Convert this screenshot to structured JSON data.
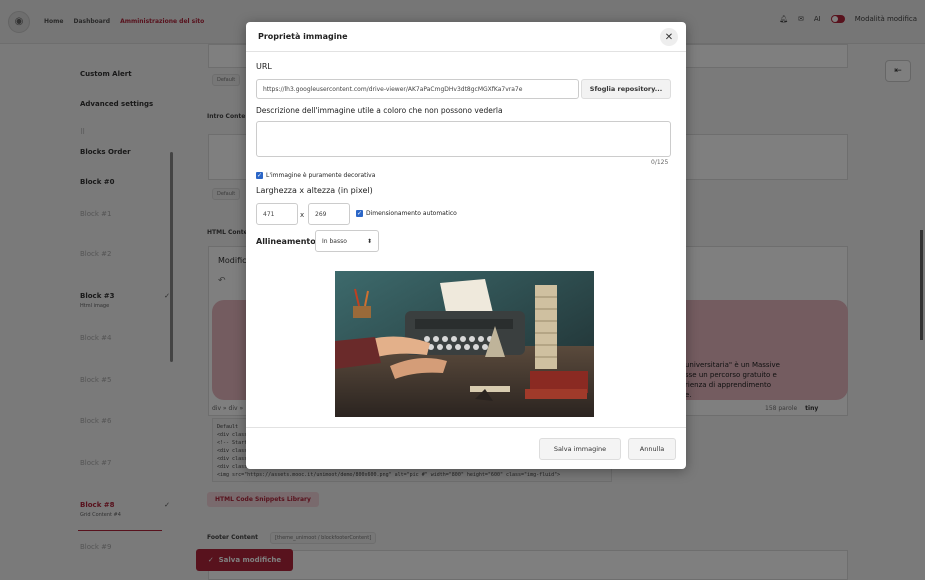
{
  "topbar": {
    "crumbs": [
      "Home",
      "Dashboard",
      "Amministrazione del sito"
    ],
    "ai_label": "AI",
    "mode_label": "Modalità modifica"
  },
  "sidebar": {
    "items": [
      {
        "label": "Custom Alert",
        "sub": ""
      },
      {
        "label": "Advanced settings",
        "sub": ""
      },
      {
        "label": "Blocks Order",
        "sub": ""
      },
      {
        "label": "Block #0",
        "sub": ""
      },
      {
        "label": "Block #1",
        "sub": ""
      },
      {
        "label": "Block #2",
        "sub": ""
      },
      {
        "label": "Block #3",
        "sub": "Html image"
      },
      {
        "label": "Block #4",
        "sub": ""
      },
      {
        "label": "Block #5",
        "sub": ""
      },
      {
        "label": "Block #6",
        "sub": ""
      },
      {
        "label": "Block #7",
        "sub": ""
      },
      {
        "label": "Block #8",
        "sub": "Grid Content #4"
      },
      {
        "label": "Block #9",
        "sub": ""
      }
    ]
  },
  "main": {
    "default_chip": "Default",
    "intro_label": "Intro Conte",
    "html_label": "HTML Conte",
    "modifica": "Modific",
    "pink_text": "universitaria\" è un Massive\nsse un percorso gratuito e\nrienza di apprendimento\ne.",
    "tiny_footer": "158 parole",
    "tiny_brand": "tiny",
    "breadcrumb_path": "div » div »",
    "code_lines": [
      "Default",
      "<div class",
      "<!-- Start -",
      "<div class",
      "<div class",
      "<div class",
      "<img src=\"https://assets.mooc.it/unimoot/demo/800x600.png\" alt=\"pic #\" width=\"800\" height=\"600\" class=\"img-fluid\">"
    ],
    "snippets_button": "HTML Code Snippets Library",
    "footer_label": "Footer Content",
    "footer_chip": "[theme_unimoot / blockfooterContent]",
    "save_button": "Salva modifiche"
  },
  "modal": {
    "title": "Proprietà immagine",
    "url_label": "URL",
    "url_value": "https://lh3.googleusercontent.com/drive-viewer/AK7aPaCmgDHv3dt8gcMGXfKa7vra7e",
    "browse_button": "Sfoglia repository...",
    "desc_label": "Descrizione dell'immagine utile a coloro che non possono vederla",
    "desc_value": "",
    "counter": "0/125",
    "decorative_label": "L'immagine è puramente decorativa",
    "size_label": "Larghezza x altezza (in pixel)",
    "width_value": "471",
    "height_value": "269",
    "x_label": "x",
    "auto_size_label": "Dimensionamento automatico",
    "align_label": "Allineamento",
    "align_value": "In basso",
    "save_image_button": "Salva immagine",
    "cancel_button": "Annulla"
  },
  "colors": {
    "accent": "#b0243a",
    "checkbox": "#2b66c7"
  }
}
